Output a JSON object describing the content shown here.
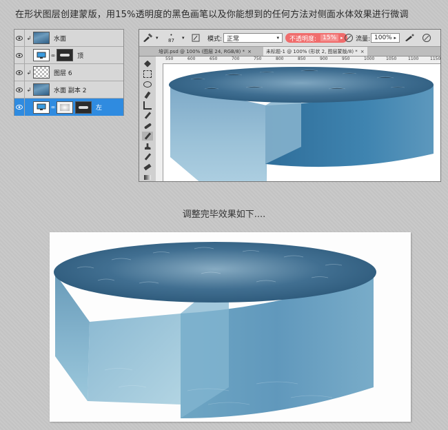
{
  "heading": "在形状图层创建蒙版，用15%透明度的黑色画笔以及你能想到的任何方法对侧面水体效果进行微调",
  "caption": "调整完毕效果如下....",
  "layers": [
    {
      "name": "水面",
      "thumb": "water",
      "linked": true,
      "active": false
    },
    {
      "name": "顶",
      "thumb": "monitor-with-mask",
      "linked": true,
      "active": false
    },
    {
      "name": "图层 6",
      "thumb": "checker",
      "linked": true,
      "active": false
    },
    {
      "name": "水面 副本 2",
      "thumb": "water",
      "linked": true,
      "active": false
    },
    {
      "name": "左",
      "thumb": "monitor-with-mask",
      "linked": false,
      "active": true
    }
  ],
  "options": {
    "brush_size": "87",
    "mode_label": "模式:",
    "mode_value": "正常",
    "opacity_label": "不透明度:",
    "opacity_value": "15%",
    "flow_label": "流量:",
    "flow_value": "100%"
  },
  "tabs": [
    {
      "label": "培训.psd @ 100% (图层 24, RGB/8) *",
      "active": false
    },
    {
      "label": "未标题-1 @ 100% (形状 2, 图层蒙版/8) *",
      "active": true
    }
  ],
  "ruler": [
    "550",
    "600",
    "650",
    "700",
    "750",
    "800",
    "850",
    "900",
    "950",
    "1000",
    "1050",
    "1100",
    "1150"
  ],
  "colors": {
    "accent": "#2f8be0",
    "opacity_highlight": "#f06c6c",
    "water_top": "#3e6f93",
    "water_side": "#4f8db5"
  },
  "icons": [
    "eye-icon",
    "brush-icon",
    "airbrush-icon",
    "dropdown-arrow-icon",
    "pen-pressure-icon"
  ]
}
